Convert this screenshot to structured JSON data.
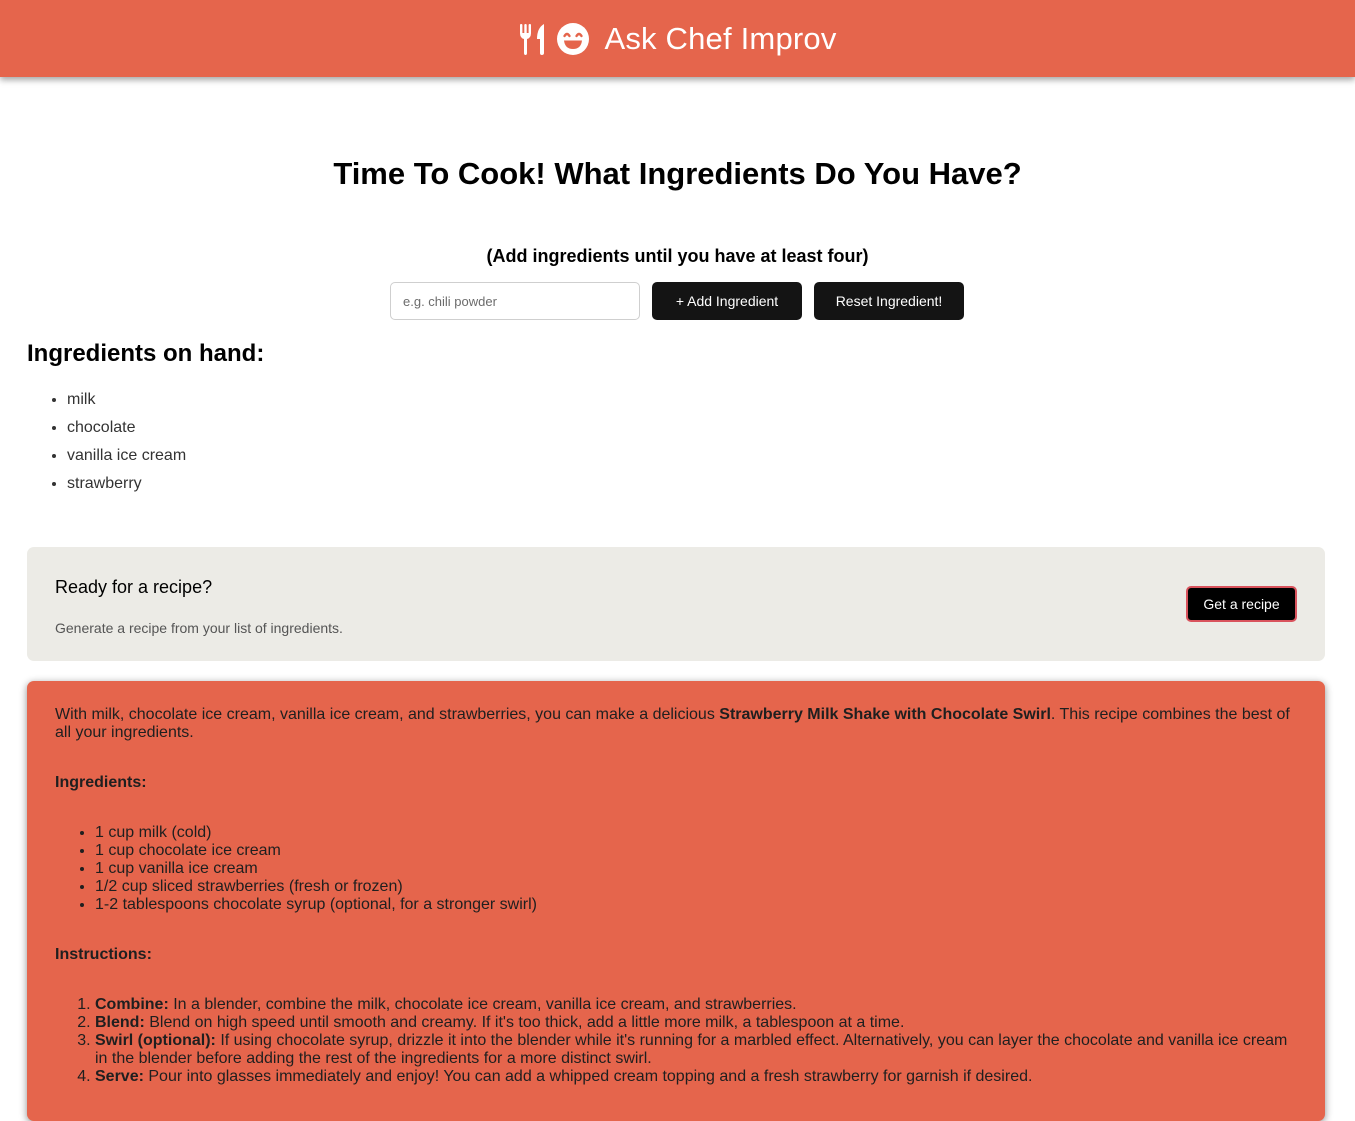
{
  "header": {
    "title": "Ask Chef Improv",
    "icons": [
      "utensils-icon",
      "grinning-face-icon"
    ]
  },
  "main": {
    "title": "Time To Cook! What Ingredients Do You Have?",
    "subtitle": "(Add ingredients until you have at least four)",
    "input_placeholder": "e.g. chili powder",
    "add_button": "+ Add Ingredient",
    "reset_button": "Reset Ingredient!"
  },
  "onhand": {
    "heading": "Ingredients on hand:",
    "items": [
      "milk",
      "chocolate",
      "vanilla ice cream",
      "strawberry"
    ]
  },
  "recipe_card": {
    "title": "Ready for a recipe?",
    "description": "Generate a recipe from your list of ingredients.",
    "button": "Get a recipe"
  },
  "recipe": {
    "intro_before": "With milk, chocolate ice cream, vanilla ice cream, and strawberries, you can make a delicious ",
    "intro_bold": "Strawberry Milk Shake with Chocolate Swirl",
    "intro_after": ". This recipe combines the best of all your ingredients.",
    "ingredients_label": "Ingredients:",
    "ingredients": [
      "1 cup milk (cold)",
      "1 cup chocolate ice cream",
      "1 cup vanilla ice cream",
      "1/2 cup sliced strawberries (fresh or frozen)",
      "1-2 tablespoons chocolate syrup (optional, for a stronger swirl)"
    ],
    "instructions_label": "Instructions:",
    "instructions": [
      {
        "label": "Combine:",
        "text": " In a blender, combine the milk, chocolate ice cream, vanilla ice cream, and strawberries."
      },
      {
        "label": "Blend:",
        "text": " Blend on high speed until smooth and creamy. If it's too thick, add a little more milk, a tablespoon at a time."
      },
      {
        "label": "Swirl (optional):",
        "text": " If using chocolate syrup, drizzle it into the blender while it's running for a marbled effect. Alternatively, you can layer the chocolate and vanilla ice cream in the blender before adding the rest of the ingredients for a more distinct swirl."
      },
      {
        "label": "Serve:",
        "text": " Pour into glasses immediately and enjoy! You can add a whipped cream topping and a fresh strawberry for garnish if desired."
      }
    ]
  },
  "colors": {
    "brand": "#e5654c",
    "card_bg": "#ecebe6",
    "button_dark": "#141414"
  }
}
